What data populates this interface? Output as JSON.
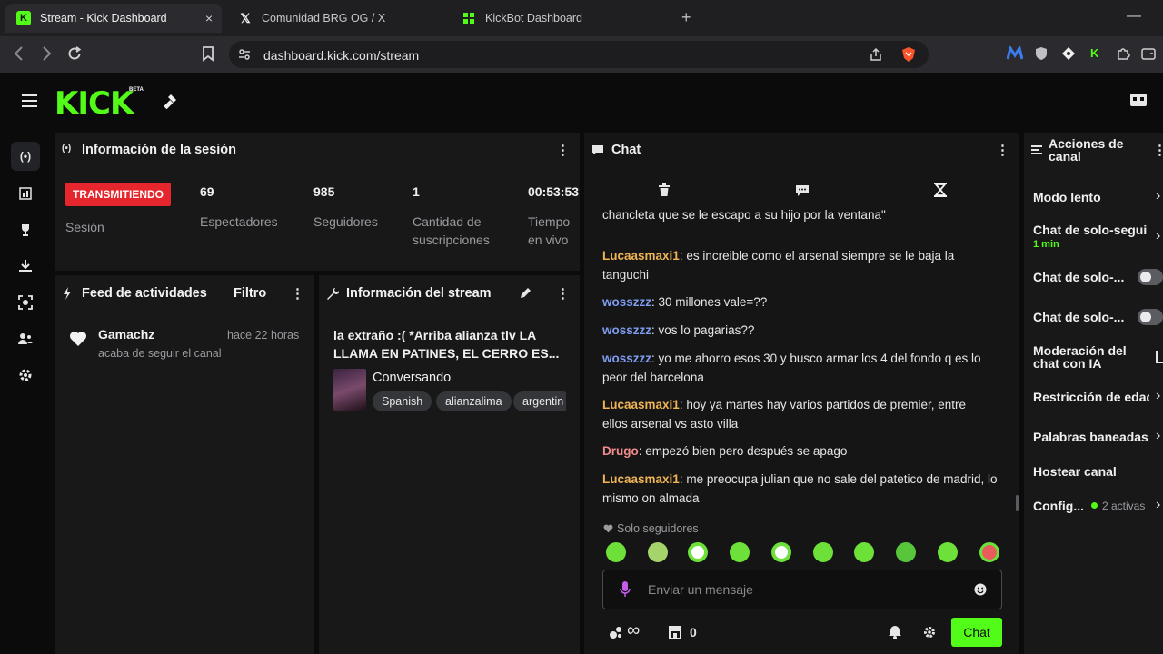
{
  "browser": {
    "tabs": [
      {
        "title": "Stream - Kick Dashboard",
        "active": true
      },
      {
        "title": "Comunidad BRG OG / X",
        "active": false
      },
      {
        "title": "KickBot Dashboard",
        "active": false
      }
    ],
    "new_tab_glyph": "+",
    "close_glyph": "×",
    "url": "dashboard.kick.com/stream",
    "accent_color": "#53fc18"
  },
  "header": {
    "logo": "KICK",
    "beta": "BETA"
  },
  "session": {
    "title": "Información de la sesión",
    "status": "TRANSMITIENDO",
    "status_label": "Sesión",
    "stats": [
      {
        "value": "69",
        "label": "Espectadores"
      },
      {
        "value": "985",
        "label": "Seguidores"
      },
      {
        "value": "1",
        "label": "Cantidad de suscripciones"
      },
      {
        "value": "00:53:53",
        "label": "Tiempo en vivo"
      }
    ]
  },
  "feed": {
    "title": "Feed de actividades",
    "filter_label": "Filtro",
    "items": [
      {
        "user": "Gamachz",
        "time": "hace 22 horas",
        "action": "acaba de seguir el canal"
      }
    ]
  },
  "stream_info": {
    "title": "Información del stream",
    "stream_title": "la extraño :( *Arriba alianza tlv LA LLAMA EN PATINES, EL CERRO ES...",
    "category": "Conversando",
    "tags": [
      "Spanish",
      "alianzalima",
      "argentin"
    ]
  },
  "chat": {
    "title": "Chat",
    "messages": [
      {
        "user": "",
        "text": "chancleta que se le escapo a su hijo por la ventana\"",
        "color": "#e6e6e6"
      },
      {
        "user": "Lucaasmaxi1",
        "text": "es increible como el arsenal siempre se le baja la tanguchi",
        "color": "#f0b454"
      },
      {
        "user": "wosszzz",
        "text": "30 millones vale=??",
        "color": "#7e9cf0"
      },
      {
        "user": "wosszzz",
        "text": "vos lo pagarias??",
        "color": "#7e9cf0"
      },
      {
        "user": "wosszzz",
        "text": "yo me ahorro esos 30 y busco armar los 4 del fondo q es lo peor del barcelona",
        "color": "#7e9cf0"
      },
      {
        "user": "Lucaasmaxi1",
        "text": "hoy ya martes hay varios partidos de premier, entre ellos arsenal vs asto villa",
        "color": "#f0b454"
      },
      {
        "user": "Drugo",
        "text": "empezó bien pero después se apago",
        "color": "#f28b8b"
      },
      {
        "user": "Lucaasmaxi1",
        "text": "me preocupa julian que no sale del patetico de madrid, lo mismo on almada",
        "color": "#f0b454"
      }
    ],
    "followers_only": "Solo seguidores",
    "input_placeholder": "Enviar un mensaje",
    "infinity": "∞",
    "shop_count": "0",
    "send_label": "Chat"
  },
  "actions": {
    "title": "Acciones de canal",
    "items": [
      {
        "label": "Modo lento",
        "control": "chevron"
      },
      {
        "label": "Chat de solo-segui",
        "sub": "1 min",
        "control": "chevron"
      },
      {
        "label": "Chat de solo-...",
        "control": "toggle"
      },
      {
        "label": "Chat de solo-...",
        "control": "toggle"
      },
      {
        "label": "Moderación del chat con IA",
        "control": "icon"
      },
      {
        "label": "Restricción de edad",
        "control": "chevron"
      },
      {
        "label": "Palabras baneadas",
        "control": "chevron"
      },
      {
        "label": "Hostear canal",
        "control": "none"
      },
      {
        "label": "Config...",
        "sub": "2 activas",
        "control": "chevron"
      }
    ]
  }
}
